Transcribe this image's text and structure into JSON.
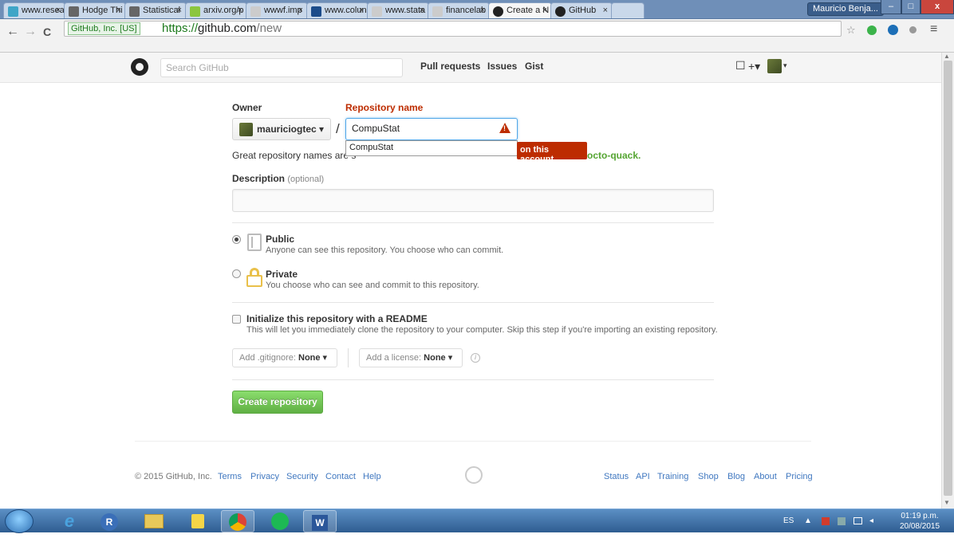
{
  "browser": {
    "tabs": [
      {
        "label": "www.resea",
        "icon_color": "#3fa5c7"
      },
      {
        "label": "Hodge Thi",
        "icon_color": "#666666"
      },
      {
        "label": "Statistical",
        "icon_color": "#666666"
      },
      {
        "label": "arxiv.org/p",
        "icon_color": "#8cc63f"
      },
      {
        "label": "wwwf.imp",
        "icon_color": "#cccccc"
      },
      {
        "label": "www.colun",
        "icon_color": "#1c4c8a"
      },
      {
        "label": "www.stata",
        "icon_color": "#cccccc"
      },
      {
        "label": "financelab",
        "icon_color": "#cccccc"
      },
      {
        "label": "Create a N",
        "icon_color": "#222222"
      },
      {
        "label": "GitHub",
        "icon_color": "#222222"
      }
    ],
    "tab_close": "×",
    "window_user": "Mauricio Benja...",
    "win_min": "–",
    "win_max": "□",
    "win_close": "x",
    "secure_label": "GitHub, Inc. [US]",
    "url_scheme": "https://",
    "url_host": "github.com",
    "url_path": "/new",
    "back": "←",
    "forward": "→",
    "reload": "C",
    "star": "☆",
    "menu": "≡"
  },
  "gh_header": {
    "search_placeholder": "Search GitHub",
    "nav": [
      "Pull requests",
      "Issues",
      "Gist"
    ],
    "plus": "+▾",
    "inbox": "☐",
    "avatar_caret": "▾"
  },
  "form": {
    "owner_label": "Owner",
    "repo_label": "Repository name",
    "owner_value": "mauriciogtec ▾",
    "slash": "/",
    "repo_value": "CompuStat",
    "autocomplete": "CompuStat",
    "error_tip": "on this account",
    "hint": "Great repository names are s",
    "hint_tail": "octo-quack.",
    "desc_label": "Description",
    "desc_optional": "(optional)",
    "public_title": "Public",
    "public_note": "Anyone can see this repository. You choose who can commit.",
    "private_title": "Private",
    "private_note": "You choose who can see and commit to this repository.",
    "readme_title": "Initialize this repository with a README",
    "readme_note": "This will let you immediately clone the repository to your computer. Skip this step if you're importing an existing repository.",
    "gitignore_label": "Add .gitignore:",
    "gitignore_value": "None ▾",
    "license_label": "Add a license:",
    "license_value": "None ▾",
    "info": "i",
    "create_button": "Create repository"
  },
  "footer": {
    "copyright": "© 2015 GitHub, Inc.",
    "left_links": [
      "Terms",
      "Privacy",
      "Security",
      "Contact",
      "Help"
    ],
    "right_links": [
      "Status",
      "API",
      "Training",
      "Shop",
      "Blog",
      "About",
      "Pricing"
    ]
  },
  "taskbar": {
    "apps": [
      "e",
      "R",
      "",
      "",
      "",
      "",
      "W"
    ],
    "lang": "ES",
    "time": "01:19 p.m.",
    "date": "20/08/2015"
  }
}
